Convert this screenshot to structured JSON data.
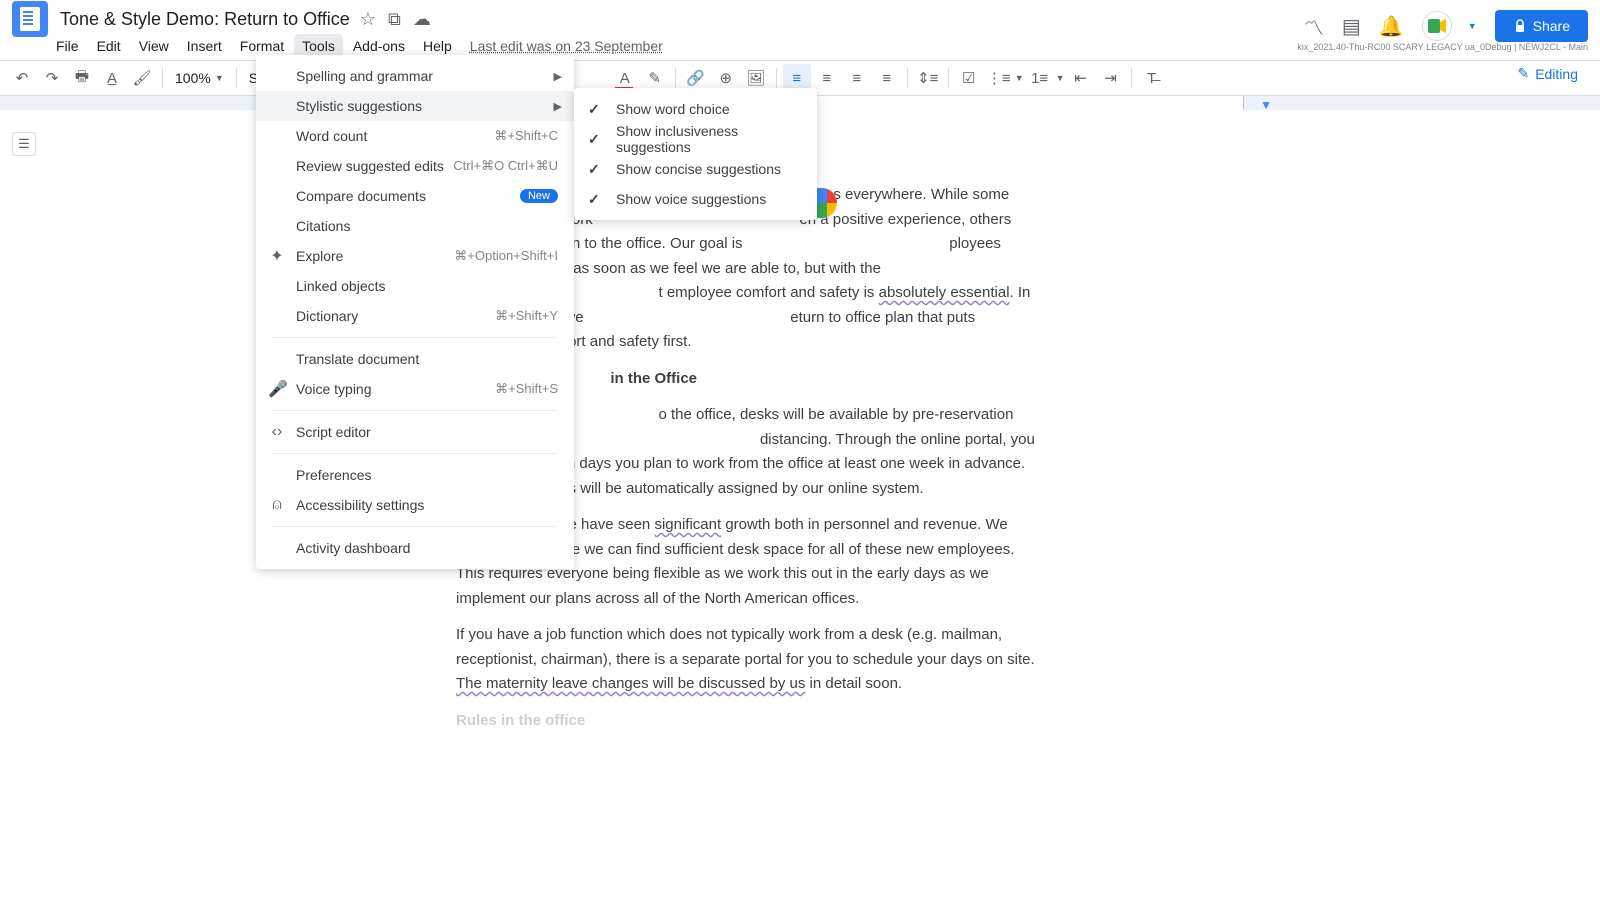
{
  "header": {
    "title": "Tone & Style Demo: Return to Office",
    "last_edit": "Last edit was on 23 September",
    "share": "Share",
    "build": "kix_2021.40-Thu-RC00 SCARY LEGACY ua_0Debug | NEWJ2CL - Main"
  },
  "menu": [
    "File",
    "Edit",
    "View",
    "Insert",
    "Format",
    "Tools",
    "Add-ons",
    "Help"
  ],
  "toolbar": {
    "zoom": "100%",
    "style": "Subtitle",
    "editing": "Editing"
  },
  "tools": {
    "items": [
      {
        "label": "Spelling and grammar",
        "arrow": true
      },
      {
        "label": "Stylistic suggestions",
        "arrow": true,
        "hover": true
      },
      {
        "label": "Word count",
        "kbd": "⌘+Shift+C"
      },
      {
        "label": "Review suggested edits",
        "kbd": "Ctrl+⌘O Ctrl+⌘U"
      },
      {
        "label": "Compare documents",
        "new": true
      },
      {
        "label": "Citations"
      },
      {
        "label": "Explore",
        "icon": "✦",
        "kbd": "⌘+Option+Shift+I"
      },
      {
        "label": "Linked objects"
      },
      {
        "label": "Dictionary",
        "kbd": "⌘+Shift+Y"
      },
      {
        "sep": true
      },
      {
        "label": "Translate document"
      },
      {
        "label": "Voice typing",
        "icon": "🎤",
        "kbd": "⌘+Shift+S"
      },
      {
        "sep": true
      },
      {
        "label": "Script editor",
        "icon": "‹›"
      },
      {
        "sep": true
      },
      {
        "label": "Preferences"
      },
      {
        "label": "Accessibility settings",
        "icon": "⍝"
      },
      {
        "sep": true
      },
      {
        "label": "Activity dashboard"
      }
    ]
  },
  "submenu": [
    "Show word choice",
    "Show inclusiveness suggestions",
    "Show concise suggestions",
    "Show voice suggestions"
  ],
  "doc": {
    "p1a": "been difficult for employees everywhere. While some employees feel work ",
    "p1b": "en a positive experience, others are eager to return to the office. Our goal is ",
    "p1c": "ployees back to the office as soon as we feel we are able to, but with the ",
    "p1d": "t employee comfort and safety is ",
    "p1e": "absolutely essential",
    "p1f": ". In order to do this, we ",
    "p1g": "eturn to office plan that puts employees' comfort and safety first.",
    "h1": " in the Office",
    "p2a": "o the office, desks will be available by pre-reservation only, to ensure ",
    "p2b": "distancing. Through the online portal, you will indicate which days you plan to work from the office at least one week in advance.  Desk reservations will be automatically assigned by our online system.",
    "p3a": "This past year, we have seen ",
    "p3b": "significant",
    "p3c": " growth both in personnel and revenue. We need to make sure we can find sufficient desk space for all of these new employees. This requires everyone being flexible as we work this out in the early days as we implement our plans across all of the North American offices.",
    "p4a": "If you have a job function which does not typically work from a desk (e.g. mailman, receptionist, chairman), there is a separate portal for you to schedule your days on site. ",
    "p4b": "The maternity leave changes will be discussed by us",
    "p4c": " in detail soon.",
    "h2": "Rules in the office"
  }
}
